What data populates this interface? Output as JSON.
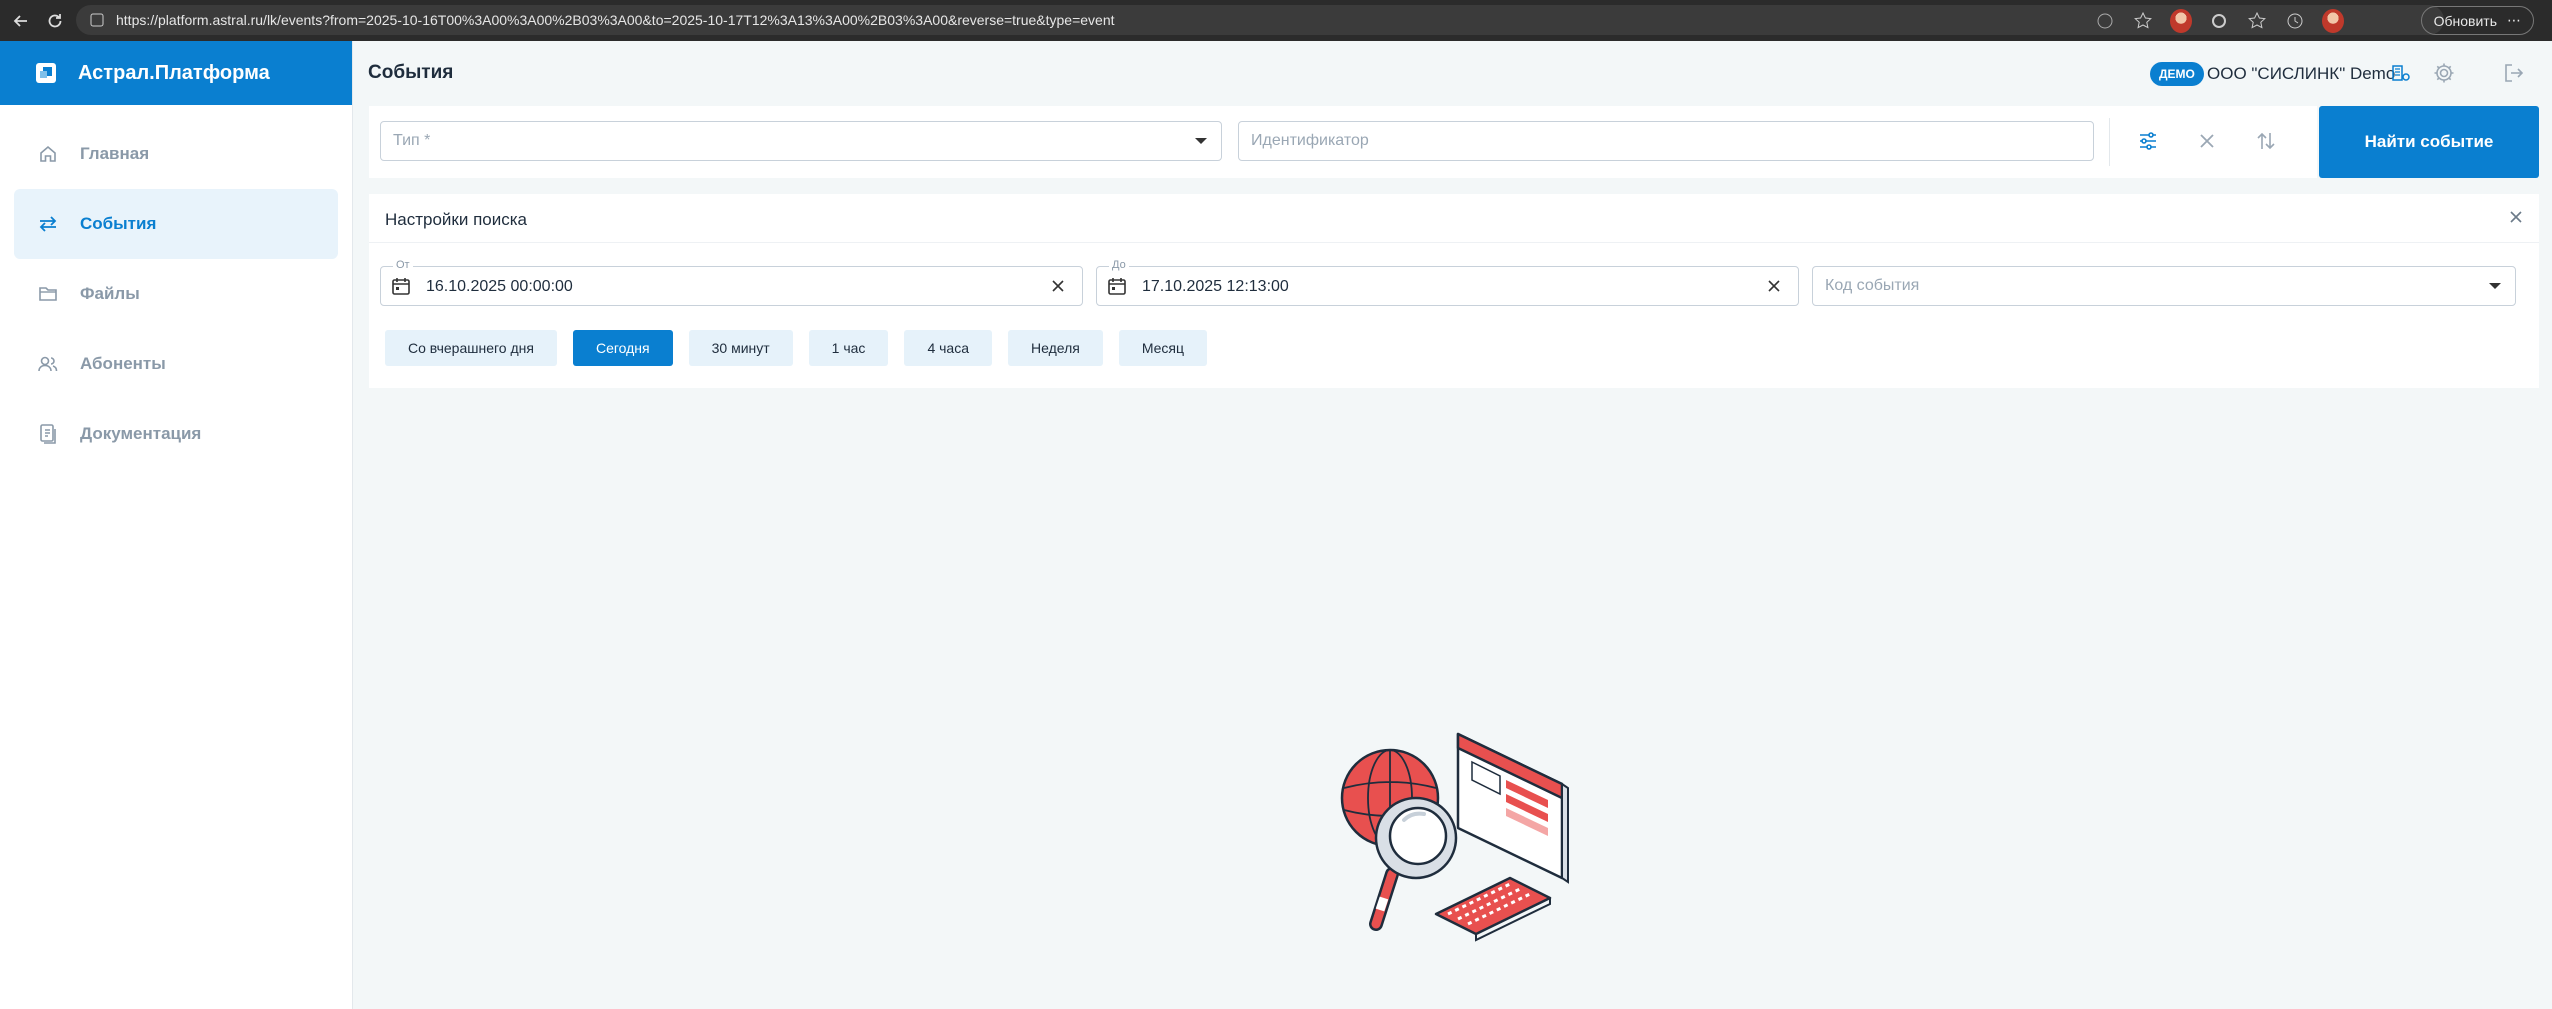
{
  "browser": {
    "url": "https://platform.astral.ru/lk/events?from=2025-10-16T00%3A00%3A00%2B03%3A00&to=2025-10-17T12%3A13%3A00%2B03%3A00&reverse=true&type=event",
    "update_label": "Обновить"
  },
  "sidebar": {
    "brand": "Астрал.Платформа",
    "items": [
      {
        "label": "Главная",
        "icon": "home-icon",
        "active": false
      },
      {
        "label": "События",
        "icon": "swap-arrows-icon",
        "active": true
      },
      {
        "label": "Файлы",
        "icon": "folder-icon",
        "active": false
      },
      {
        "label": "Абоненты",
        "icon": "users-icon",
        "active": false
      },
      {
        "label": "Документация",
        "icon": "document-icon",
        "active": false
      }
    ]
  },
  "header": {
    "title": "События",
    "demo_badge": "ДЕМО",
    "org_name": "ООО \"СИСЛИНК\" Demo"
  },
  "filters": {
    "type_placeholder": "Тип *",
    "id_placeholder": "Идентификатор",
    "find_button": "Найти событие"
  },
  "search_settings": {
    "title": "Настройки поиска",
    "from_label": "От",
    "from_value": "16.10.2025 00:00:00",
    "to_label": "До",
    "to_value": "17.10.2025 12:13:00",
    "code_placeholder": "Код события",
    "presets": [
      {
        "label": "Со вчерашнего дня",
        "active": false
      },
      {
        "label": "Сегодня",
        "active": true
      },
      {
        "label": "30 минут",
        "active": false
      },
      {
        "label": "1 час",
        "active": false
      },
      {
        "label": "4 часа",
        "active": false
      },
      {
        "label": "Неделя",
        "active": false
      },
      {
        "label": "Месяц",
        "active": false
      }
    ]
  },
  "colors": {
    "accent": "#0a7fd0",
    "accent_light": "#e6f2fa",
    "illustration_red": "#e8504f"
  }
}
